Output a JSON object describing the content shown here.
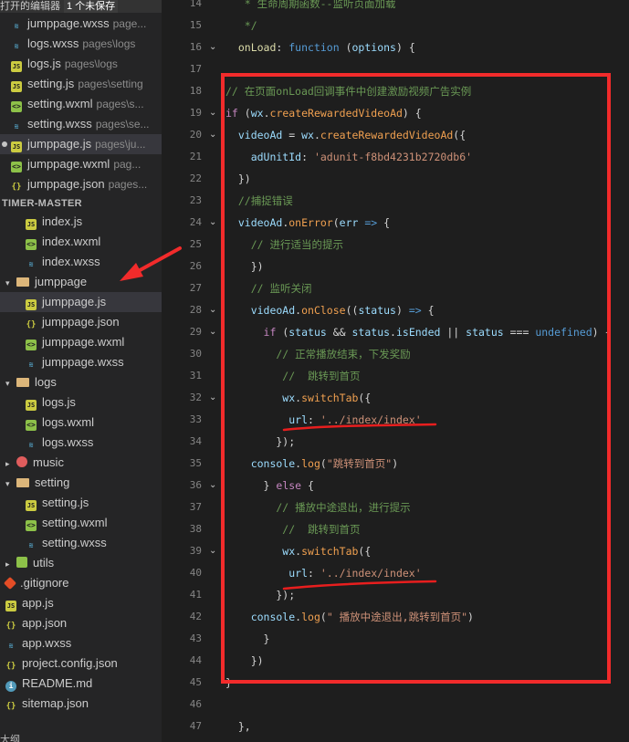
{
  "sidebar": {
    "open_editors_title": "打开的编辑器",
    "unsaved_badge": "1 个未保存",
    "open_editors": [
      {
        "name": "jumppage.wxss",
        "path": "page...",
        "type": "wxss"
      },
      {
        "name": "logs.wxss",
        "path": "pages\\logs",
        "type": "wxss"
      },
      {
        "name": "logs.js",
        "path": "pages\\logs",
        "type": "js"
      },
      {
        "name": "setting.js",
        "path": "pages\\setting",
        "type": "js"
      },
      {
        "name": "setting.wxml",
        "path": "pages\\s...",
        "type": "wxml"
      },
      {
        "name": "setting.wxss",
        "path": "pages\\se...",
        "type": "wxss"
      },
      {
        "name": "jumppage.js",
        "path": "pages\\ju...",
        "type": "js",
        "modified": true
      },
      {
        "name": "jumppage.wxml",
        "path": "pag...",
        "type": "wxml"
      },
      {
        "name": "jumppage.json",
        "path": "pages...",
        "type": "json"
      }
    ],
    "project_title": "TIMER-MASTER",
    "tree": [
      {
        "name": "index.js",
        "type": "js",
        "indent": 2
      },
      {
        "name": "index.wxml",
        "type": "wxml",
        "indent": 2
      },
      {
        "name": "index.wxss",
        "type": "wxss",
        "indent": 2
      },
      {
        "name": "jumppage",
        "type": "folder-open",
        "indent": 1,
        "chevron": "▾"
      },
      {
        "name": "jumppage.js",
        "type": "js",
        "indent": 2,
        "selected": true
      },
      {
        "name": "jumppage.json",
        "type": "json",
        "indent": 2
      },
      {
        "name": "jumppage.wxml",
        "type": "wxml",
        "indent": 2
      },
      {
        "name": "jumppage.wxss",
        "type": "wxss",
        "indent": 2
      },
      {
        "name": "logs",
        "type": "folder-open",
        "indent": 1,
        "chevron": "▾"
      },
      {
        "name": "logs.js",
        "type": "js",
        "indent": 2
      },
      {
        "name": "logs.wxml",
        "type": "wxml",
        "indent": 2
      },
      {
        "name": "logs.wxss",
        "type": "wxss",
        "indent": 2
      },
      {
        "name": "music",
        "type": "music",
        "indent": 1,
        "chevron": "▸"
      },
      {
        "name": "setting",
        "type": "folder-open",
        "indent": 1,
        "chevron": "▾"
      },
      {
        "name": "setting.js",
        "type": "js",
        "indent": 2
      },
      {
        "name": "setting.wxml",
        "type": "wxml",
        "indent": 2
      },
      {
        "name": "setting.wxss",
        "type": "wxss",
        "indent": 2
      },
      {
        "name": "utils",
        "type": "utils",
        "indent": 0,
        "chevron": "▸"
      },
      {
        "name": ".gitignore",
        "type": "git",
        "indent": 0
      },
      {
        "name": "app.js",
        "type": "js",
        "indent": 0
      },
      {
        "name": "app.json",
        "type": "json",
        "indent": 0
      },
      {
        "name": "app.wxss",
        "type": "wxss",
        "indent": 0
      },
      {
        "name": "project.config.json",
        "type": "json",
        "indent": 0
      },
      {
        "name": "README.md",
        "type": "info",
        "indent": 0
      },
      {
        "name": "sitemap.json",
        "type": "json",
        "indent": 0
      }
    ],
    "bottom_label": "大纲"
  },
  "editor": {
    "lines": [
      {
        "n": "14",
        "parts": [
          [
            "c-com",
            "   * 生命周期函数--监听页面加载"
          ]
        ]
      },
      {
        "n": "15",
        "parts": [
          [
            "c-com",
            "   */"
          ]
        ]
      },
      {
        "n": "16",
        "fold": true,
        "parts": [
          [
            "c-fn",
            "  onLoad"
          ],
          [
            "",
            ": "
          ],
          [
            "c-kw",
            "function"
          ],
          [
            "",
            " ("
          ],
          [
            "c-var",
            "options"
          ],
          [
            "",
            ") {"
          ]
        ]
      },
      {
        "n": "17",
        "parts": []
      },
      {
        "n": "18",
        "parts": [
          [
            "c-com",
            "// 在页面onLoad回调事件中创建激励视频广告实例"
          ]
        ]
      },
      {
        "n": "19",
        "fold": true,
        "parts": [
          [
            "c-key",
            "if"
          ],
          [
            "",
            " ("
          ],
          [
            "c-var",
            "wx"
          ],
          [
            "",
            "."
          ],
          [
            "c-fn2",
            "createRewardedVideoAd"
          ],
          [
            "",
            ") {"
          ]
        ]
      },
      {
        "n": "20",
        "fold": true,
        "parts": [
          [
            "c-var",
            "  videoAd"
          ],
          [
            "",
            " = "
          ],
          [
            "c-var",
            "wx"
          ],
          [
            "",
            "."
          ],
          [
            "c-fn2",
            "createRewardedVideoAd"
          ],
          [
            "",
            "({"
          ]
        ]
      },
      {
        "n": "21",
        "parts": [
          [
            "c-var",
            "    adUnitId"
          ],
          [
            "",
            ": "
          ],
          [
            "c-str",
            "'adunit-f8bd4231b2720db6'"
          ]
        ]
      },
      {
        "n": "22",
        "parts": [
          [
            "",
            "  })"
          ]
        ]
      },
      {
        "n": "23",
        "parts": [
          [
            "c-com",
            "  //捕捉错误"
          ]
        ]
      },
      {
        "n": "24",
        "fold": true,
        "parts": [
          [
            "c-var",
            "  videoAd"
          ],
          [
            "",
            "."
          ],
          [
            "c-fn2",
            "onError"
          ],
          [
            "",
            "("
          ],
          [
            "c-var",
            "err"
          ],
          [
            "c-kw",
            " =>"
          ],
          [
            "",
            " {"
          ]
        ]
      },
      {
        "n": "25",
        "parts": [
          [
            "c-com",
            "    // 进行适当的提示"
          ]
        ]
      },
      {
        "n": "26",
        "parts": [
          [
            "",
            "    })"
          ]
        ]
      },
      {
        "n": "27",
        "parts": [
          [
            "c-com",
            "    // 监听关闭"
          ]
        ]
      },
      {
        "n": "28",
        "fold": true,
        "parts": [
          [
            "c-var",
            "    videoAd"
          ],
          [
            "",
            "."
          ],
          [
            "c-fn2",
            "onClose"
          ],
          [
            "",
            "(("
          ],
          [
            "c-var",
            "status"
          ],
          [
            "",
            ") "
          ],
          [
            "c-kw",
            "=>"
          ],
          [
            "",
            " {"
          ]
        ]
      },
      {
        "n": "29",
        "fold": true,
        "parts": [
          [
            "c-key",
            "      if"
          ],
          [
            "",
            " ("
          ],
          [
            "c-var",
            "status"
          ],
          [
            "",
            " && "
          ],
          [
            "c-var",
            "status"
          ],
          [
            "",
            "."
          ],
          [
            "c-var",
            "isEnded"
          ],
          [
            "",
            " || "
          ],
          [
            "c-var",
            "status"
          ],
          [
            "",
            " === "
          ],
          [
            "c-kw",
            "undefined"
          ],
          [
            "",
            ") {"
          ]
        ]
      },
      {
        "n": "30",
        "parts": [
          [
            "c-com",
            "        // 正常播放结束，下发奖励"
          ]
        ]
      },
      {
        "n": "31",
        "parts": [
          [
            "c-com",
            "         //  跳转到首页"
          ]
        ]
      },
      {
        "n": "32",
        "fold": true,
        "parts": [
          [
            "c-var",
            "         wx"
          ],
          [
            "",
            "."
          ],
          [
            "c-fn2",
            "switchTab"
          ],
          [
            "",
            "({"
          ]
        ]
      },
      {
        "n": "33",
        "parts": [
          [
            "c-var",
            "          url"
          ],
          [
            "",
            ": "
          ],
          [
            "c-str",
            "'../index/index'"
          ]
        ]
      },
      {
        "n": "34",
        "parts": [
          [
            "",
            "        });"
          ]
        ]
      },
      {
        "n": "35",
        "parts": [
          [
            "c-var",
            "    console"
          ],
          [
            "",
            "."
          ],
          [
            "c-fn2",
            "log"
          ],
          [
            "",
            "("
          ],
          [
            "c-str",
            "\"跳转到首页\""
          ],
          [
            "",
            ")"
          ]
        ]
      },
      {
        "n": "36",
        "fold": true,
        "parts": [
          [
            "",
            "      } "
          ],
          [
            "c-key",
            "else"
          ],
          [
            "",
            " {"
          ]
        ]
      },
      {
        "n": "37",
        "parts": [
          [
            "c-com",
            "        // 播放中途退出，进行提示"
          ]
        ]
      },
      {
        "n": "38",
        "parts": [
          [
            "c-com",
            "         //  跳转到首页"
          ]
        ]
      },
      {
        "n": "39",
        "fold": true,
        "parts": [
          [
            "c-var",
            "         wx"
          ],
          [
            "",
            "."
          ],
          [
            "c-fn2",
            "switchTab"
          ],
          [
            "",
            "({"
          ]
        ]
      },
      {
        "n": "40",
        "parts": [
          [
            "c-var",
            "          url"
          ],
          [
            "",
            ": "
          ],
          [
            "c-str",
            "'../index/index'"
          ]
        ]
      },
      {
        "n": "41",
        "parts": [
          [
            "",
            "        });"
          ]
        ]
      },
      {
        "n": "42",
        "parts": [
          [
            "c-var",
            "    console"
          ],
          [
            "",
            "."
          ],
          [
            "c-fn2",
            "log"
          ],
          [
            "",
            "("
          ],
          [
            "c-str",
            "\" 播放中途退出,跳转到首页\""
          ],
          [
            "",
            ")"
          ]
        ]
      },
      {
        "n": "43",
        "parts": [
          [
            "",
            "      }"
          ]
        ]
      },
      {
        "n": "44",
        "parts": [
          [
            "",
            "    })"
          ]
        ]
      },
      {
        "n": "45",
        "parts": [
          [
            "",
            "}"
          ]
        ]
      },
      {
        "n": "46",
        "parts": []
      },
      {
        "n": "47",
        "parts": [
          [
            "",
            "  },"
          ]
        ]
      }
    ]
  },
  "colors": {
    "highlight_box": "#f22b2b",
    "annotation_arrow": "#f22b2b",
    "underline": "#e81e1e"
  }
}
